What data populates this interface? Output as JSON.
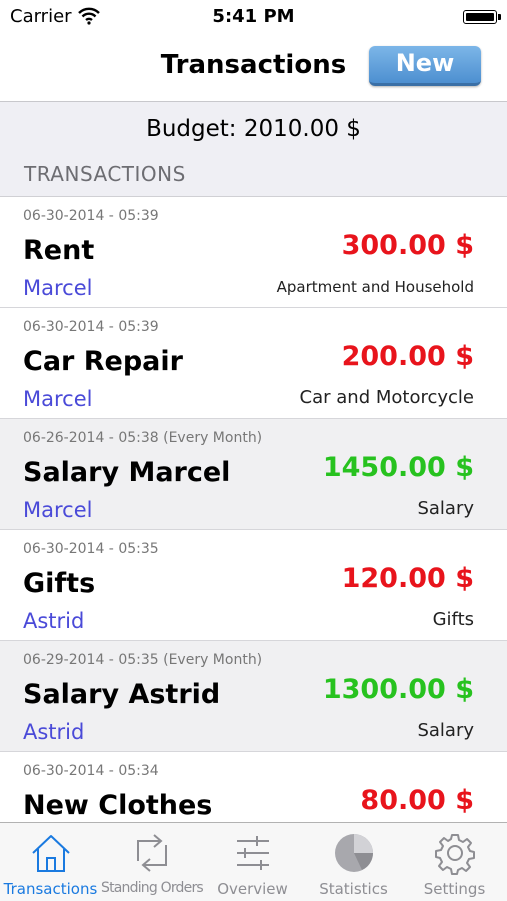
{
  "status_bar": {
    "carrier": "Carrier",
    "time": "5:41 PM"
  },
  "nav": {
    "title": "Transactions",
    "new_button": "New"
  },
  "budget": "Budget: 2010.00 $",
  "section_header": "TRANSACTIONS",
  "transactions": [
    {
      "date": "06-30-2014 - 05:39",
      "title": "Rent",
      "amount": "300.00 $",
      "type": "expense",
      "person": "Marcel",
      "category": "Apartment and Household"
    },
    {
      "date": "06-30-2014 - 05:39",
      "title": "Car Repair",
      "amount": "200.00 $",
      "type": "expense",
      "person": "Marcel",
      "category": "Car and Motorcycle"
    },
    {
      "date": "06-26-2014 - 05:38 (Every Month)",
      "title": "Salary Marcel",
      "amount": "1450.00 $",
      "type": "income",
      "person": "Marcel",
      "category": "Salary"
    },
    {
      "date": "06-30-2014 - 05:35",
      "title": "Gifts",
      "amount": "120.00 $",
      "type": "expense",
      "person": "Astrid",
      "category": "Gifts"
    },
    {
      "date": "06-29-2014 - 05:35 (Every Month)",
      "title": "Salary Astrid",
      "amount": "1300.00 $",
      "type": "income",
      "person": "Astrid",
      "category": "Salary"
    },
    {
      "date": "06-30-2014 - 05:34",
      "title": "New Clothes",
      "amount": "80.00 $",
      "type": "expense",
      "person": "",
      "category": ""
    }
  ],
  "tabs": [
    {
      "label": "Transactions",
      "icon": "house-icon",
      "active": true
    },
    {
      "label": "Standing Orders",
      "icon": "repeat-icon",
      "active": false
    },
    {
      "label": "Overview",
      "icon": "sliders-icon",
      "active": false
    },
    {
      "label": "Statistics",
      "icon": "pie-chart-icon",
      "active": false
    },
    {
      "label": "Settings",
      "icon": "gear-icon",
      "active": false
    }
  ],
  "colors": {
    "expense": "#e8141c",
    "income": "#27c21f",
    "person": "#4a4ad8",
    "tab_active": "#1a7ae0",
    "tab_inactive": "#8e8e93"
  }
}
